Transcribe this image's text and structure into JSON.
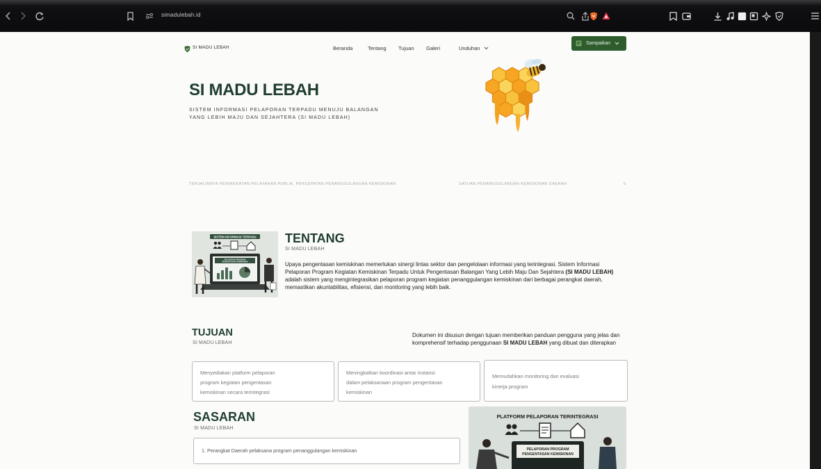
{
  "browser": {
    "url": "simadulebah.id",
    "icons": [
      "back-icon",
      "forward-icon",
      "reload-icon",
      "bookmark-icon",
      "site-info-icon",
      "search-icon",
      "share-icon",
      "brave-shields-icon",
      "brave-rewards-icon",
      "sidebar-icon",
      "wallet-icon",
      "download-icon",
      "media-icon",
      "tab-icon",
      "split-view-icon",
      "extensions-icon",
      "vpn-icon",
      "menu-icon"
    ]
  },
  "colors": {
    "brand_green": "#2e5c2d",
    "heading_green": "#1f3e2e",
    "honey_orange": "#f4a21f",
    "brave_orange": "#f26b2a"
  },
  "nav": {
    "logo_text": "SI MADU LEBAH",
    "links": [
      "Beranda",
      "Tentang",
      "Tujuan",
      "Galeri",
      "Unduhan"
    ],
    "button_label": "Sampaikan"
  },
  "hero": {
    "title": "SI MADU LEBAH",
    "subtitle_lines": [
      "SISTEM INFORMASI PELAPORAN TERPADU MENUJU BALANGAN",
      "YANG LEBIH MAJU DAN SEJAHTERA (SI MADU LEBAH)"
    ]
  },
  "ticker": {
    "left": "TERJALINNYA PENINGKATAN PELAYANAN PUBLIK, PERCEPATAN PENANGGULANGAN KEMISKINAN",
    "right": "SATUAN PENANGGULANGAN KEMISKINAN DAERAH",
    "end": "5"
  },
  "tentang": {
    "title": "TENTANG",
    "subtitle": "SI MADU LEBAH",
    "illustration": {
      "banner": "SISTEM INFORMASI TERPADU",
      "screen_line1": "PELAPORAN PROGRAM",
      "screen_line2": "PENGENTASAN KEMISKINAN"
    },
    "paragraph": {
      "line1": "Upaya pengentasan kemiskinan memerlukan sinergi lintas sektor dan pengelolaan informasi yang terintegrasi. Sistem Informasi",
      "line2": "Pelaporan Program Kegiatan Kemiskinan Terpadu Untuk Pengentasan Balangan Yang Lebih Maju Dan Sejahtera",
      "line2_bold": "(SI MADU LEBAH)",
      "line3": "adalah sistem yang mengintegrasikan pelaporan program kegiatan penanggulangan kemiskinan dari berbagai perangkat daerah,",
      "line4": "memastikan akuntabilitas, efisiensi, dan monitoring yang lebih baik."
    }
  },
  "tujuan": {
    "title": "TUJUAN",
    "subtitle": "SI MADU LEBAH",
    "description": {
      "line1": "Dokumen ini disusun dengan tujuan memberikan panduan pengguna yang jelas dan",
      "line2_before": "komprehensif terhadap penggunaan",
      "line2_bold": "SI MADU LEBAH",
      "line2_after": "yang dibuat dan diterapkan"
    },
    "cards": [
      {
        "lines": [
          "Menyediakan platform pelaporan",
          "program kegiatan pengentasan",
          "kemiskinan secara terintegrasi"
        ]
      },
      {
        "lines": [
          "Meningkatkan koordinasi antar instansi",
          "dalam pelaksanaan program pengentasan",
          "kemiskinan"
        ]
      },
      {
        "lines": [
          "Memudahkan monitoring dan evaluasi",
          "kinerja program"
        ]
      }
    ]
  },
  "sasaran": {
    "title": "SASARAN",
    "subtitle": "SI MADU LEBAH",
    "items": [
      "1. Perangkat Daerah pelaksana program penanggulangan kemiskinan"
    ],
    "illustration": {
      "title": "PLATFORM PELAPORAN TERINTEGRASI",
      "screen_line1": "PELAPORAN PROGRAM",
      "screen_line2": "PENGENTASAN KEMISKINAN"
    }
  }
}
